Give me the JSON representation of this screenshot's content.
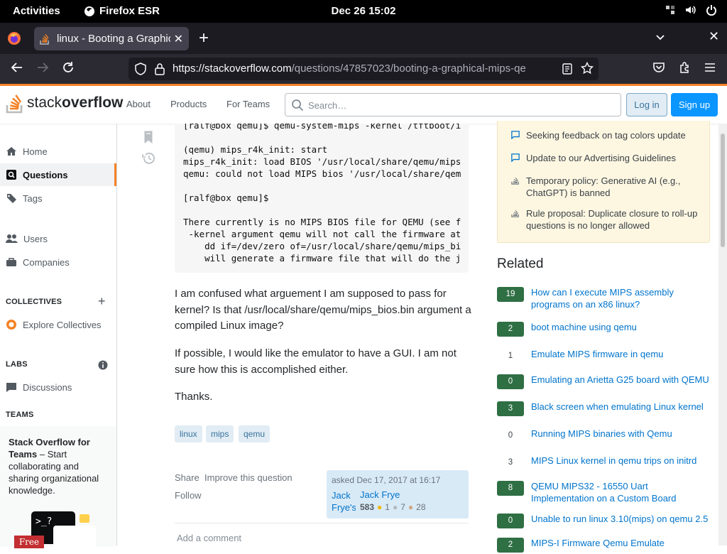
{
  "gnome": {
    "activities": "Activities",
    "app_name": "Firefox ESR",
    "clock": "Dec 26  15:02"
  },
  "browser": {
    "tab_title": "linux - Booting a Graphical",
    "url_host": "https://stackoverflow.com",
    "url_path": "/questions/47857023/booting-a-graphical-mips-qe"
  },
  "so_header": {
    "logo_light": "stack",
    "logo_bold": "overflow",
    "nav": [
      "About",
      "Products",
      "For Teams"
    ],
    "search_placeholder": "Search…",
    "login": "Log in",
    "signup": "Sign up"
  },
  "left_nav": {
    "home": "Home",
    "questions": "Questions",
    "tags": "Tags",
    "users": "Users",
    "companies": "Companies",
    "collectives_head": "COLLECTIVES",
    "explore_collectives": "Explore Collectives",
    "labs_head": "LABS",
    "discussions": "Discussions",
    "teams_head": "TEAMS",
    "teams_title": "Stack Overflow for Teams",
    "teams_body": " – Start collaborating and sharing organizational knowledge.",
    "free_badge": "Free",
    "promo_code": ">_?"
  },
  "question": {
    "code": "[ralf@box qemu]$ qemu-system-mips -kernel /tftboot/i\n\n(qemu) mips_r4k_init: start\nmips_r4k_init: load BIOS '/usr/local/share/qemu/mips\nqemu: could not load MIPS bios '/usr/local/share/qem\n\n[ralf@box qemu]$\n\nThere currently is no MIPS BIOS file for QEMU (see f\n -kernel argument qemu will not call the firmware at\n    dd if=/dev/zero of=/usr/local/share/qemu/mips_bi\n    will generate a firmware file that will do the j",
    "para1": "I am confused what arguement I am supposed to pass for kernel? Is that /usr/local/share/qemu/mips_bios.bin argument a compiled Linux image?",
    "para2": "If possible, I would like the emulator to have a GUI. I am not sure how this is accomplished either.",
    "para3": "Thanks.",
    "tags": [
      "linux",
      "mips",
      "qemu"
    ],
    "share": "Share",
    "improve": "Improve this question",
    "follow": "Follow",
    "asked": "asked Dec 17, 2017 at 16:17",
    "avatar_alt": "Jack Frye's",
    "user_name": "Jack Frye",
    "reputation": "583",
    "gold": "1",
    "silver": "7",
    "bronze": "28",
    "add_comment": "Add a comment"
  },
  "meta": [
    "Seeking feedback on tag colors update",
    "Update to our Advertising Guidelines",
    "Temporary policy: Generative AI (e.g., ChatGPT) is banned",
    "Rule proposal: Duplicate closure to roll-up questions is no longer allowed"
  ],
  "related": {
    "title": "Related",
    "items": [
      {
        "score": "19",
        "answered": true,
        "title": "How can I execute MIPS assembly programs on an x86 linux?"
      },
      {
        "score": "2",
        "answered": true,
        "title": "boot machine using qemu"
      },
      {
        "score": "1",
        "answered": false,
        "title": "Emulate MIPS firmware in qemu"
      },
      {
        "score": "0",
        "answered": true,
        "title": "Emulating an Arietta G25 board with QEMU"
      },
      {
        "score": "3",
        "answered": true,
        "title": "Black screen when emulating Linux kernel"
      },
      {
        "score": "0",
        "answered": false,
        "title": "Running MIPS binaries with Qemu"
      },
      {
        "score": "3",
        "answered": false,
        "title": "MIPS Linux kernel in qemu trips on initrd"
      },
      {
        "score": "8",
        "answered": true,
        "title": "QEMU MIPS32 - 16550 Uart Implementation on a Custom Board"
      },
      {
        "score": "0",
        "answered": true,
        "title": "Unable to run linux 3.10(mips) on qemu 2.5"
      },
      {
        "score": "2",
        "answered": true,
        "title": "MIPS-I Firmware Qemu Emulate"
      }
    ]
  },
  "colors": {
    "so_orange": "#f48225",
    "so_blue": "#0a95ff",
    "link": "#0074cc",
    "answered_green": "#2f6f44"
  }
}
